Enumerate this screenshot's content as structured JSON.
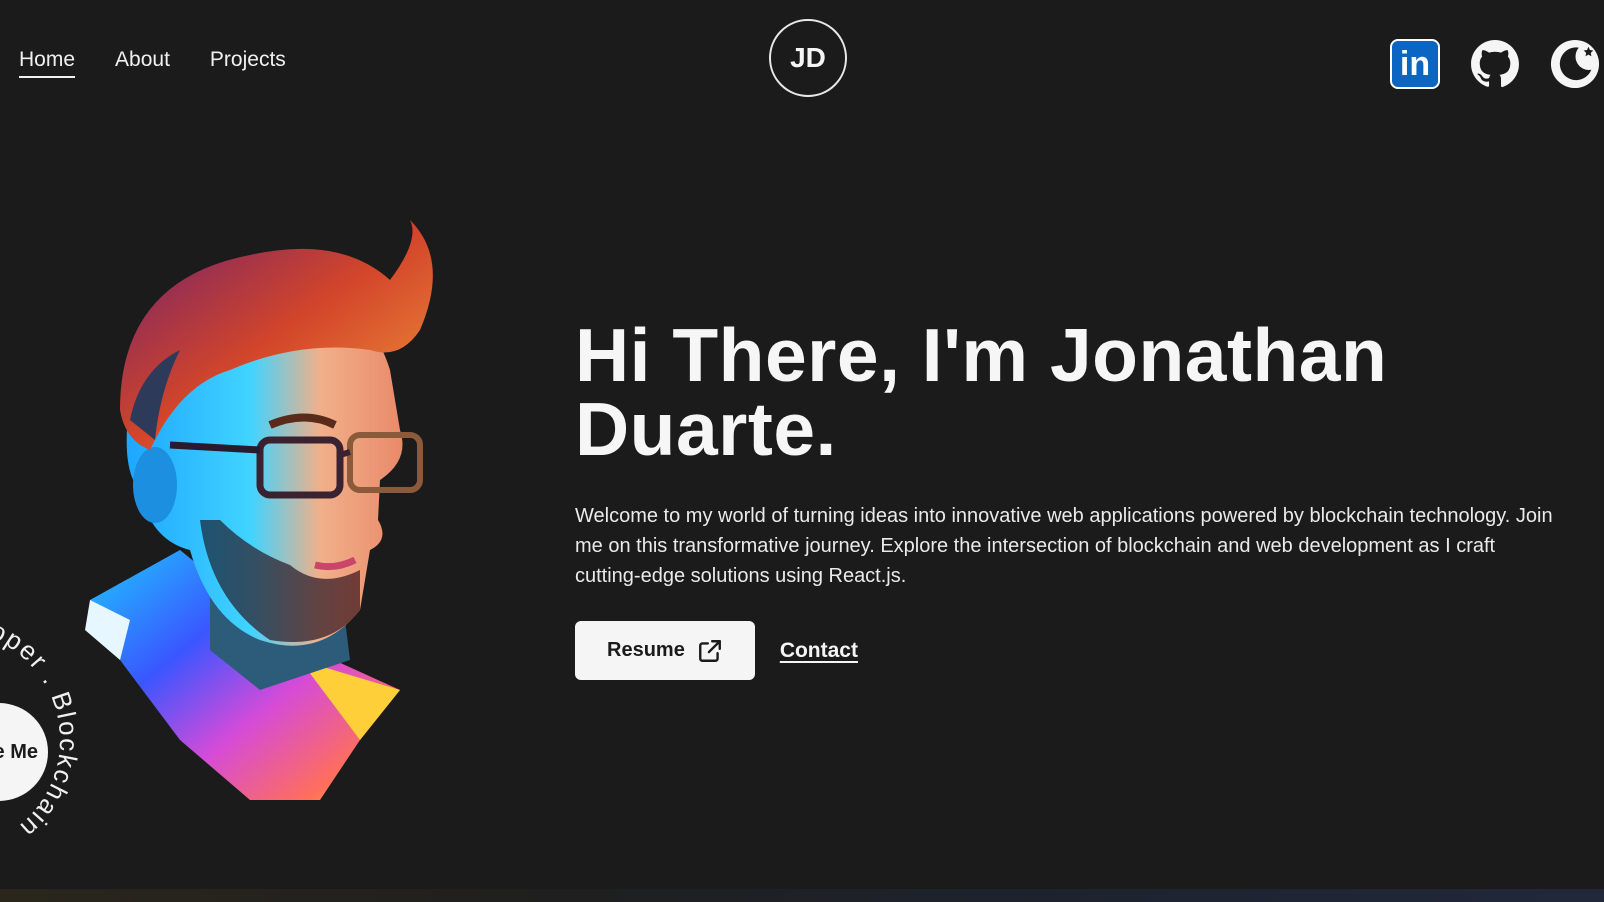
{
  "nav": {
    "links": [
      {
        "label": "Home",
        "active": true
      },
      {
        "label": "About",
        "active": false
      },
      {
        "label": "Projects",
        "active": false
      }
    ],
    "logo": "JD"
  },
  "social": {
    "linkedin_label": "in",
    "icons": [
      "linkedin-icon",
      "github-icon",
      "theme-moon-icon"
    ]
  },
  "hero": {
    "headline": "Hi There, I'm Jonathan Duarte.",
    "intro": "Welcome to my world of turning ideas into innovative web applications powered by blockchain technology. Join me on this transformative journey. Explore the intersection of blockchain and web development as I craft cutting-edge solutions using React.js.",
    "resume_label": "Resume",
    "contact_label": "Contact",
    "rotating_text": "veloper . Blockchain",
    "hire_label": "e Me"
  },
  "colors": {
    "background": "#1b1b1b",
    "text": "#f5f5f5",
    "linkedin": "#0a66c2"
  }
}
